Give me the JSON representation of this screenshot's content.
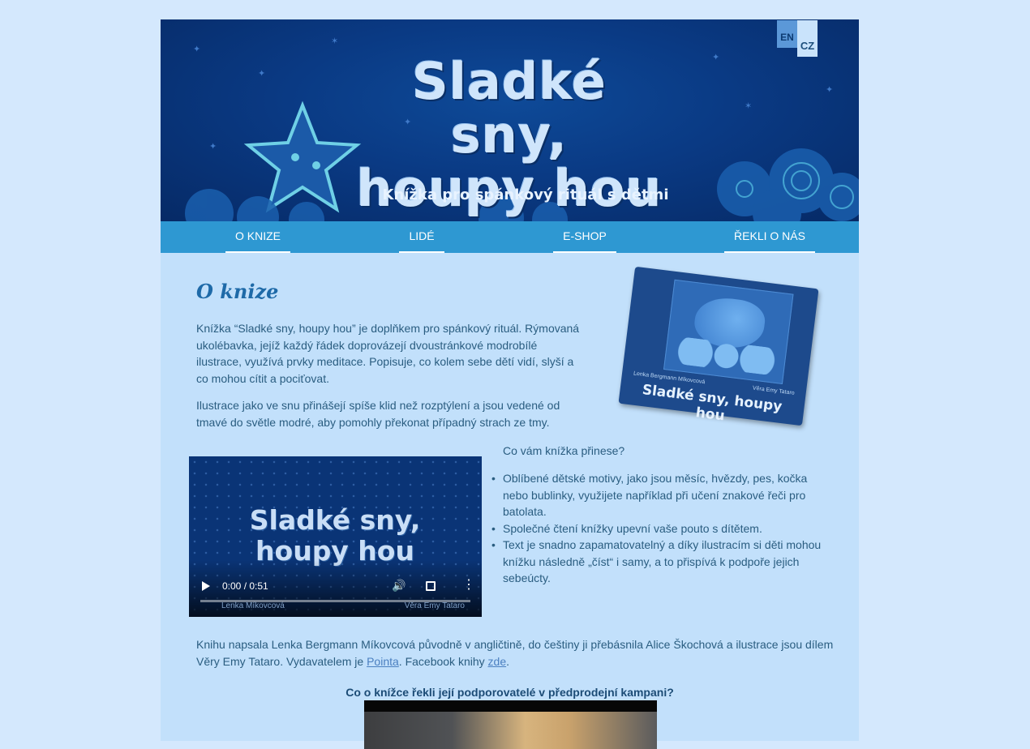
{
  "header": {
    "title": "Sladké sny, houpy hou",
    "subtitle": "Knížka pro spánkový rituál s dětmi",
    "lang_en": "EN",
    "lang_cz": "CZ"
  },
  "nav": {
    "items": [
      {
        "label": "O KNIZE"
      },
      {
        "label": "LIDÉ"
      },
      {
        "label": "E-SHOP"
      },
      {
        "label": "ŘEKLI O NÁS"
      }
    ]
  },
  "main": {
    "heading": "O knize",
    "paragraph1": "Knížka “Sladké sny, houpy hou” je doplňkem pro spánkový rituál. Rýmovaná ukolébavka, jejíž každý řádek doprovázejí dvoustránkové modrobílé ilustrace, využívá prvky meditace. Popisuje, co kolem sebe dětí vidí, slyší a co mohou cítit a pociťovat.",
    "paragraph2": "Ilustrace jako ve snu přinášejí spíše klid než rozptýlení a jsou vedené od tmavé do světle modré, aby pomohly překonat případný strach ze tmy.",
    "book_cover": {
      "title": "Sladké sny, houpy hou",
      "author": "Lenka Bergmann Míkovcová",
      "illustrator": "Věra Emy Tataro"
    },
    "video": {
      "title": "Sladké sny, houpy hou",
      "time": "0:00 / 0:51",
      "credit_left": "Lenka Míkovcová",
      "credit_right": "Věra Emy Tataro"
    },
    "benefits_question": "Co vám knížka přinese?",
    "benefits": [
      "Oblíbené dětské motivy, jako jsou měsíc, hvězdy, pes, kočka nebo bublinky, využijete například při učení znakové řeči pro batolata.",
      "Společné čtení knížky upevní vaše pouto s dítětem.",
      "Text je snadno zapamatovatelný a díky ilustracím si děti mohou knížku následně „číst“ i samy, a to přispívá k podpoře jejich sebeúcty."
    ],
    "credits_text_1": "Knihu napsala Lenka Bergmann Míkovcová původně v angličtině, do češtiny ji přebásnila Alice Škochová a ilustrace jsou dílem Věry Emy Tataro. Vydavatelem je ",
    "publisher_link": "Pointa",
    "credits_text_2": ". Facebook knihy ",
    "facebook_link": "zde",
    "credits_text_3": ".",
    "supporters_question": "Co o knížce řekli její podporovatelé v předprodejní kampani?"
  },
  "colors": {
    "page_bg": "#d4e8fd",
    "content_bg": "#c2e0fb",
    "nav_bg": "#2e98d2",
    "banner_bg": "#0a3a84",
    "heading": "#1e6aa8",
    "text": "#2a5d80",
    "link": "#4a7fc0"
  }
}
